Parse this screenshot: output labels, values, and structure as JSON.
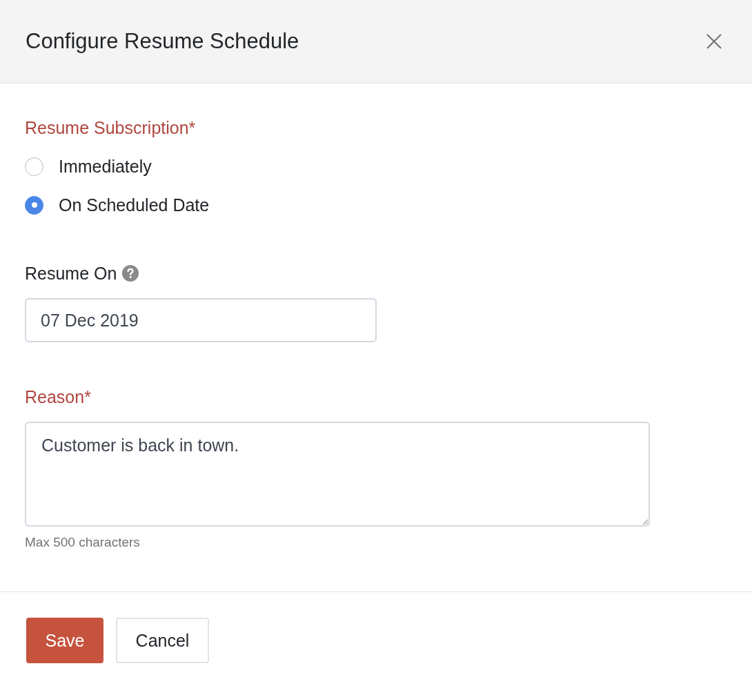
{
  "dialog": {
    "title": "Configure Resume Schedule"
  },
  "fields": [
    {
      "kind": "radio_group",
      "label": "Resume Subscription*",
      "required": true,
      "options": [
        {
          "label": "Immediately",
          "selected": false
        },
        {
          "label": "On Scheduled Date",
          "selected": true
        }
      ]
    },
    {
      "kind": "date",
      "label": "Resume On",
      "required": false,
      "help": true,
      "value": "07 Dec 2019"
    },
    {
      "kind": "textarea",
      "label": "Reason*",
      "required": true,
      "value": "Customer is back in town.",
      "hint": "Max 500 characters"
    }
  ],
  "buttons": [
    {
      "label": "Save",
      "kind": "primary"
    },
    {
      "label": "Cancel",
      "kind": "secondary"
    }
  ]
}
